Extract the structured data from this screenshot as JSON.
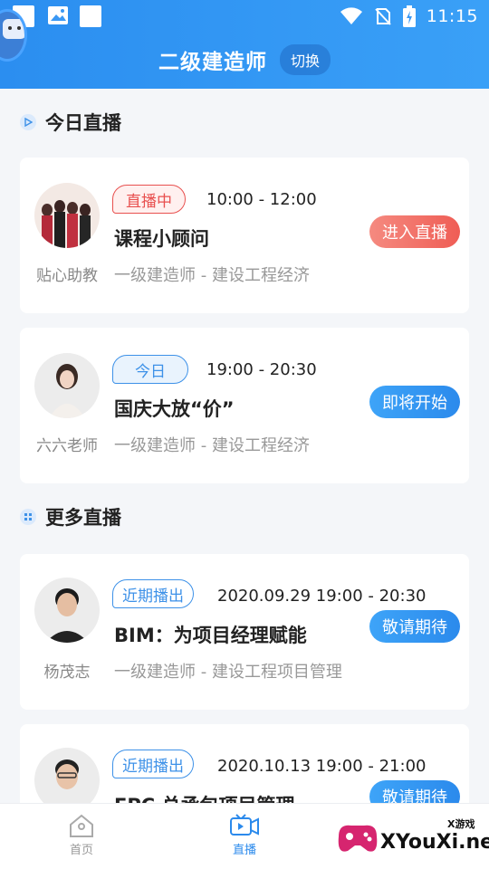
{
  "status_bar": {
    "time": "11:15"
  },
  "header": {
    "title": "二级建造师",
    "switch_label": "切换"
  },
  "sections": {
    "today": {
      "title": "今日直播"
    },
    "more": {
      "title": "更多直播"
    }
  },
  "cards": [
    {
      "tag": "直播中",
      "time": "10:00 - 12:00",
      "name": "课程小顾问",
      "teacher": "贴心助教",
      "subtitle": "一级建造师 - 建设工程经济",
      "button": "进入直播"
    },
    {
      "tag": "今日",
      "time": "19:00 - 20:30",
      "name": "国庆大放“价”",
      "teacher": "六六老师",
      "subtitle": "一级建造师 - 建设工程经济",
      "button": "即将开始"
    },
    {
      "tag": "近期播出",
      "time": "2020.09.29 19:00 - 20:30",
      "name": "BIM：为项目经理赋能",
      "teacher": "杨茂志",
      "subtitle": "一级建造师 - 建设工程项目管理",
      "button": "敬请期待"
    },
    {
      "tag": "近期播出",
      "time": "2020.10.13 19:00 - 21:00",
      "name": "EPC 总承包项目管理",
      "teacher": "",
      "subtitle": "",
      "button": "敬请期待"
    }
  ],
  "bottom_nav": [
    {
      "label": "首页",
      "icon": "home-icon"
    },
    {
      "label": "直播",
      "icon": "live-video-icon"
    }
  ],
  "watermark": {
    "text": "XYouXi.net",
    "small": "X游戏"
  }
}
